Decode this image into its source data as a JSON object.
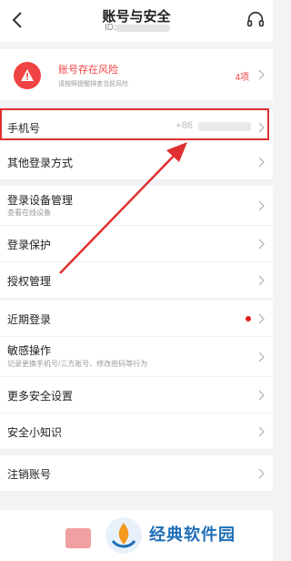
{
  "header": {
    "title": "账号与安全",
    "id_label": "ID:"
  },
  "risk": {
    "title": "账号存在风险",
    "desc": "请按照提醒排查当前风险",
    "count": "4项"
  },
  "phone": {
    "label": "手机号",
    "prefix": "+86"
  },
  "items": {
    "other_login": "其他登录方式",
    "device_mgmt": "登录设备管理",
    "device_mgmt_sub": "查看在线设备",
    "login_protect": "登录保护",
    "auth_mgmt": "授权管理",
    "recent_login": "近期登录",
    "sensitive_ops": "敏感操作",
    "sensitive_ops_sub": "记录更换手机号/三方账号、修改密码等行为",
    "more_security": "更多安全设置",
    "security_tips": "安全小知识",
    "cancel_account": "注销账号"
  },
  "watermark": {
    "text": "经典软件园"
  },
  "colors": {
    "accent": "#f04343",
    "highlight": "#e03030",
    "watermark": "#1f6fb8"
  }
}
